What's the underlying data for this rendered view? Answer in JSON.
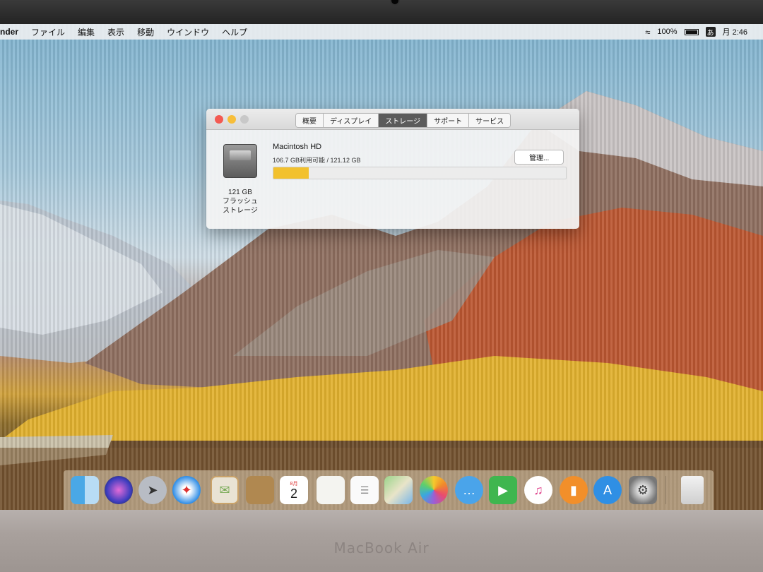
{
  "device": {
    "model": "MacBook Air"
  },
  "menubar": {
    "app_name": "nder",
    "items": [
      "ファイル",
      "編集",
      "表示",
      "移動",
      "ウインドウ",
      "ヘルプ"
    ],
    "battery_percent": "100%",
    "ime_label": "あ",
    "clock": "月 2:46"
  },
  "window": {
    "tabs": [
      "概要",
      "ディスプレイ",
      "ストレージ",
      "サポート",
      "サービス"
    ],
    "active_tab": "ストレージ",
    "disk": {
      "caption_line1": "121 GB",
      "caption_line2": "フラッシュ",
      "caption_line3": "ストレージ"
    },
    "volume": {
      "name": "Macintosh HD",
      "usage_text": "106.7 GB利用可能 / 121.12 GB",
      "used_fraction": 0.12
    },
    "manage_button_label": "管理..."
  },
  "dock": {
    "apps": [
      "Finder",
      "Siri",
      "Launchpad",
      "Safari",
      "Mail",
      "Contacts",
      "Calendar",
      "Notes",
      "Reminders",
      "Maps",
      "Photos",
      "Messages",
      "FaceTime",
      "iTunes",
      "iBooks",
      "App Store",
      "System Preferences",
      "Trash"
    ],
    "calendar_month": "8月",
    "calendar_day": "2"
  }
}
